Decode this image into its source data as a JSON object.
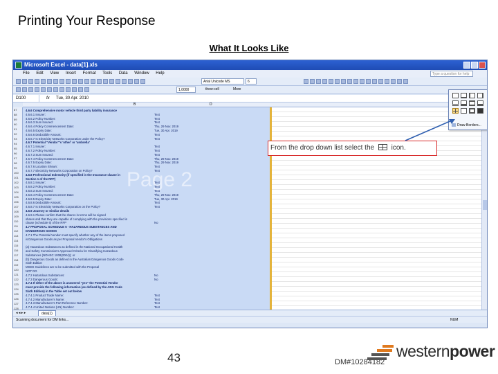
{
  "slide": {
    "title": "Printing Your Response",
    "subtitle": "What It Looks Like",
    "page_number": "43",
    "doc_ref": "DM#10284182",
    "callout_before": "From the drop down list select the",
    "callout_after": "icon."
  },
  "logo": {
    "part1": "western",
    "part2": "power"
  },
  "excel": {
    "app_title": "Microsoft Excel - data[1].xls",
    "menu": [
      "File",
      "Edit",
      "View",
      "Insert",
      "Format",
      "Tools",
      "Data",
      "Window",
      "Help"
    ],
    "ask_placeholder": "Type a question for help",
    "font_name": "Arial Unicode MS",
    "font_size": "6",
    "zoom": "1,0000",
    "toolbar_text1": "thew-cell",
    "toolbar_text2": "More",
    "name_box": "D100",
    "fx": "fx",
    "formula_value": "Tue, 30 Apr. 2010",
    "col_b": "B",
    "col_d": "D",
    "watermark": "Page 2",
    "sheet_tab": "data(1)",
    "status": "Scanning document for DM links...",
    "num": "NUM",
    "dropdown_label": "Draw Borders...",
    "row_numbers": [
      "87",
      "88",
      "89",
      "90",
      "91",
      "92",
      "93",
      "94",
      "95",
      "96",
      "97",
      "98",
      "99",
      "100",
      "101",
      "102",
      "103",
      "104",
      "105",
      "106",
      "107",
      "108",
      "109",
      "110",
      "111",
      "112",
      "113",
      "114",
      "115",
      "116",
      "117",
      "118",
      "119",
      "120",
      "121",
      "122",
      "123",
      "124",
      "125",
      "126",
      "127",
      "128",
      "129",
      "130",
      "131",
      "132",
      "133",
      "134",
      "135",
      "136",
      "137",
      "138",
      "139",
      "140",
      "141",
      "142"
    ],
    "rows": [
      {
        "label": "4.6.6 Comprehensive motor vehicle third party liability insurance",
        "value": "",
        "bold": true
      },
      {
        "label": "4.6.6.1 Insurer:",
        "value": "Text"
      },
      {
        "label": "4.6.6.2 Policy Number:",
        "value": "Text"
      },
      {
        "label": "4.6.6.3 Sum Insured:",
        "value": "Text"
      },
      {
        "label": "4.6.6.4 Policy Commencement Date:",
        "value": "Thu, 29 Nov. 2019"
      },
      {
        "label": "4.6.6.5 Expiry Date:",
        "value": "Tue, 30 Apr. 2019"
      },
      {
        "label": "4.6.6.6 Deductible Amount:",
        "value": "Text"
      },
      {
        "label": "4.6.6.7 Is Electricity Networks Corporation under the Policy?",
        "value": "Text"
      },
      {
        "label": "4.6.7 Potential \"Vendor\"'s 'other' or 'umbrella'",
        "value": "",
        "bold": true
      },
      {
        "label": "4.6.7.1 Insurer:",
        "value": "Text"
      },
      {
        "label": "4.6.7.2 Policy Number:",
        "value": "Text"
      },
      {
        "label": "4.6.7.3 Sum Insured:",
        "value": "Text"
      },
      {
        "label": "4.6.7.4 Policy Commencement Date:",
        "value": "Thu, 29 Nov. 2019"
      },
      {
        "label": "4.6.7.5 Expiry Date:",
        "value": "Thu, 29 Nov. 2019"
      },
      {
        "label": "4.6.7.6 Location Shown:",
        "value": "Text"
      },
      {
        "label": "4.6.7.7 Electricity Networks Corporation on Policy?",
        "value": "Text"
      },
      {
        "label": "4.6.8 Professional Indemnity (if specified in the Insurance clause in",
        "value": "",
        "bold": true
      },
      {
        "label": "Section 1 of the RFP)",
        "value": "",
        "bold": true
      },
      {
        "label": "4.6.8.1 Insurer:",
        "value": "Text"
      },
      {
        "label": "4.6.8.2 Policy Number:",
        "value": "Text"
      },
      {
        "label": "4.6.8.3 Sum Insured:",
        "value": "Text"
      },
      {
        "label": "4.6.8.4 Policy Commencement Date:",
        "value": "Thu, 29 Nov. 2019"
      },
      {
        "label": "4.6.8.5 Expiry Date:",
        "value": "Tue, 30 Apr. 2019"
      },
      {
        "label": "4.6.8.6 Deductible Amount:",
        "value": "Text"
      },
      {
        "label": "4.6.8.7 Is Electricity Networks Corporation on the Policy?",
        "value": "Text"
      },
      {
        "label": "4.6.9 Journey or Similar details",
        "value": "",
        "bold": true
      },
      {
        "label": "4.6.9.1 Please confirm that the shares in terms will be signed",
        "value": ""
      },
      {
        "label": "shares and that they are capable of complying with the provisions specified in",
        "value": ""
      },
      {
        "label": "clause (schedule 6) of the RFP",
        "value": "No"
      },
      {
        "label": "4.7 PROPOSAL SCHEDULE 5 - HAZARDOUS SUBSTANCES AND",
        "value": "",
        "bold": true
      },
      {
        "label": "DANGEROUS GOODS",
        "value": "",
        "bold": true
      },
      {
        "label": "4.7.1 The Potential Vendor must specify whether any of the items proposed",
        "value": ""
      },
      {
        "label": "is Dangerous Goods as per Proposal Vendor's Obligations",
        "value": ""
      },
      {
        "label": "",
        "value": ""
      },
      {
        "label": "(a) Hazardous Substances as defined in the National Occupational Health",
        "value": ""
      },
      {
        "label": "and Safety Commission's Approved Criteria for Classifying Hazardous",
        "value": ""
      },
      {
        "label": "Substances (NOHSC 1008(2004)); or",
        "value": ""
      },
      {
        "label": "(b) Dangerous Goods as defined in the Australian Dangerous Goods Code",
        "value": ""
      },
      {
        "label": "Sixth Edition",
        "value": ""
      },
      {
        "label": "MSDS Guidelines are to be submitted with the Proposal",
        "value": ""
      },
      {
        "label": "NOT DG",
        "value": ""
      },
      {
        "label": "4.7.2 Hazardous Substances:",
        "value": "No"
      },
      {
        "label": "4.7.3 Dangerous Goods:",
        "value": "No"
      },
      {
        "label": "4.7.4 If either of the above is answered \"yes\" the Potential Vendor",
        "value": "",
        "bold": true
      },
      {
        "label": "must provide the following information (as defined by the ADG Code",
        "value": "",
        "bold": true
      },
      {
        "label": "Sixth Edition) in the Table set out below",
        "value": "",
        "bold": true
      },
      {
        "label": "4.7.4.1 Product Trade Name:",
        "value": "Text"
      },
      {
        "label": "4.7.4.2 Manufacturer's Name:",
        "value": "Text"
      },
      {
        "label": "4.7.4.3 Manufacturer's Part Reference Number:",
        "value": "Text"
      },
      {
        "label": "4.7.4.4 United Nations (UN) Number:",
        "value": "Text"
      }
    ]
  },
  "colors": {
    "callout_border": "#d82b2b",
    "grid_fill": "#c9daf5",
    "selection_border": "#e4b33a"
  },
  "icons": [
    "excel-app-icon",
    "all-borders-icon",
    "arrow-pointer-icon",
    "westernpower-logo-icon"
  ]
}
